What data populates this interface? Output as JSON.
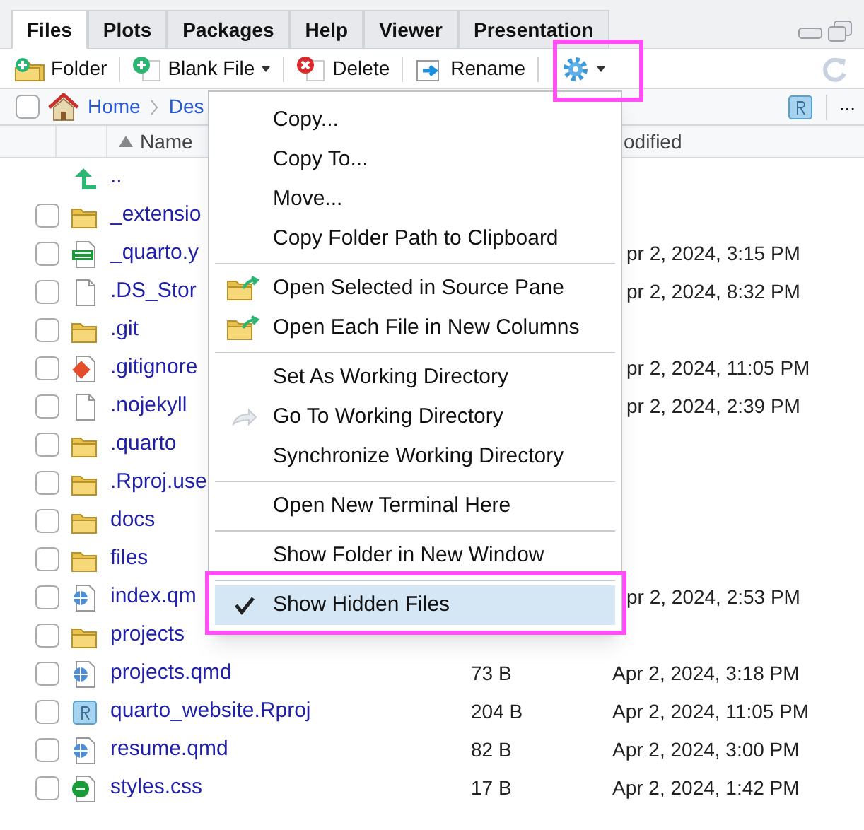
{
  "tabs": [
    {
      "label": "Files",
      "selected": true
    },
    {
      "label": "Plots",
      "selected": false
    },
    {
      "label": "Packages",
      "selected": false
    },
    {
      "label": "Help",
      "selected": false
    },
    {
      "label": "Viewer",
      "selected": false
    },
    {
      "label": "Presentation",
      "selected": false
    }
  ],
  "toolbar": [
    {
      "kind": "folder",
      "label": "Folder"
    },
    {
      "kind": "blank",
      "label": "Blank File",
      "dropdown": true
    },
    {
      "kind": "delete",
      "label": "Delete"
    },
    {
      "kind": "rename",
      "label": "Rename"
    },
    {
      "kind": "gear",
      "dropdown": true
    }
  ],
  "breadcrumb": [
    "Home",
    "Des"
  ],
  "more_label": "...",
  "select_all_checked": false,
  "columns": {
    "name": "Name",
    "modified": "odified"
  },
  "files": [
    {
      "kind": "parent",
      "name": ".."
    },
    {
      "kind": "folder",
      "name": "_extensio",
      "checked": false
    },
    {
      "kind": "yaml",
      "name": "_quarto.y",
      "modified": "pr 2, 2024, 3:15 PM",
      "checked": false
    },
    {
      "kind": "blank",
      "name": ".DS_Stor",
      "modified": "pr 2, 2024, 8:32 PM",
      "checked": false
    },
    {
      "kind": "folder",
      "name": ".git",
      "checked": false
    },
    {
      "kind": "git",
      "name": ".gitignore",
      "modified": "pr 2, 2024, 11:05 PM",
      "checked": false
    },
    {
      "kind": "blank",
      "name": ".nojekyll",
      "modified": "pr 2, 2024, 2:39 PM",
      "checked": false
    },
    {
      "kind": "folder",
      "name": ".quarto",
      "checked": false
    },
    {
      "kind": "folder",
      "name": ".Rproj.use",
      "checked": false
    },
    {
      "kind": "folder",
      "name": "docs",
      "checked": false
    },
    {
      "kind": "folder",
      "name": "files",
      "checked": false
    },
    {
      "kind": "quarto",
      "name": "index.qm",
      "modified": "pr 2, 2024, 2:53 PM",
      "checked": false
    },
    {
      "kind": "folder",
      "name": "projects",
      "checked": false
    },
    {
      "kind": "quarto",
      "name": "projects.qmd",
      "size": "73 B",
      "modified": "Apr 2, 2024, 3:18 PM",
      "checked": false
    },
    {
      "kind": "rproj",
      "name": "quarto_website.Rproj",
      "size": "204 B",
      "modified": "Apr 2, 2024, 11:05 PM",
      "checked": false
    },
    {
      "kind": "quarto",
      "name": "resume.qmd",
      "size": "82 B",
      "modified": "Apr 2, 2024, 3:00 PM",
      "checked": false
    },
    {
      "kind": "css",
      "name": "styles.css",
      "size": "17 B",
      "modified": "Apr 2, 2024, 1:42 PM",
      "checked": false
    }
  ],
  "menu": [
    {
      "kind": "plain",
      "label": "Copy..."
    },
    {
      "kind": "plain",
      "label": "Copy To..."
    },
    {
      "kind": "plain",
      "label": "Move..."
    },
    {
      "kind": "plain",
      "label": "Copy Folder Path to Clipboard"
    },
    {
      "kind": "separator"
    },
    {
      "kind": "open",
      "label": "Open Selected in Source Pane"
    },
    {
      "kind": "open",
      "label": "Open Each File in New Columns"
    },
    {
      "kind": "separator"
    },
    {
      "kind": "plain",
      "label": "Set As Working Directory"
    },
    {
      "kind": "goto",
      "label": "Go To Working Directory"
    },
    {
      "kind": "plain",
      "label": "Synchronize Working Directory"
    },
    {
      "kind": "separator"
    },
    {
      "kind": "plain",
      "label": "Open New Terminal Here"
    },
    {
      "kind": "separator"
    },
    {
      "kind": "plain",
      "label": "Show Folder in New Window"
    },
    {
      "kind": "separator"
    },
    {
      "kind": "check",
      "label": "Show Hidden Files",
      "checked": true,
      "selected": true
    }
  ]
}
